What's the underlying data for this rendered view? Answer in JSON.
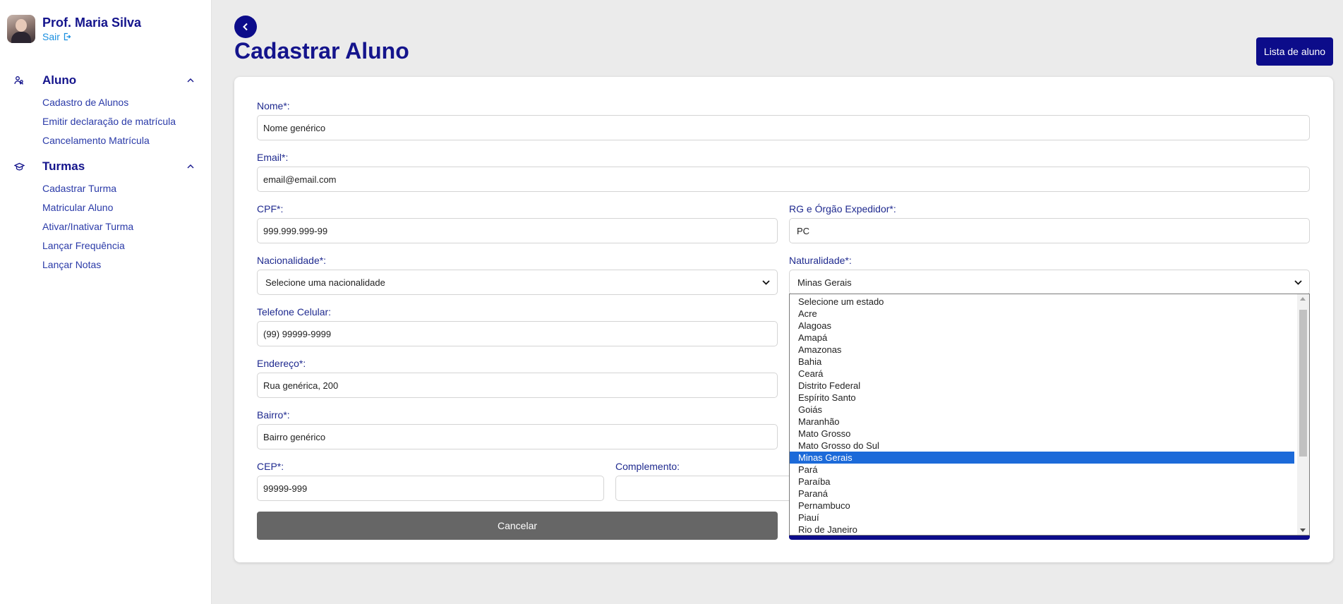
{
  "colors": {
    "primary": "#0c0c8a",
    "title": "#14148c",
    "link": "#1a8fe0",
    "cancel": "#666666",
    "selected_option": "#1c6ad9"
  },
  "sidebar": {
    "profile": {
      "name": "Prof. Maria Silva",
      "logout": "Sair"
    },
    "sections": [
      {
        "label": "Aluno",
        "icon": "users-icon",
        "items": [
          "Cadastro de Alunos",
          "Emitir declaração de matrícula",
          "Cancelamento Matrícula"
        ]
      },
      {
        "label": "Turmas",
        "icon": "graduation-cap-icon",
        "items": [
          "Cadastrar Turma",
          "Matricular Aluno",
          "Ativar/Inativar Turma",
          "Lançar Frequência",
          "Lançar Notas"
        ]
      }
    ]
  },
  "header": {
    "title": "Cadastrar Aluno",
    "list_button": "Lista de aluno"
  },
  "form": {
    "nome": {
      "label": "Nome*:",
      "value": "Nome genérico"
    },
    "email": {
      "label": "Email*:",
      "value": "email@email.com"
    },
    "cpf": {
      "label": "CPF*:",
      "value": "999.999.999-99"
    },
    "rg": {
      "label": "RG e Órgão Expedidor*:",
      "value": "PC"
    },
    "nacionalidade": {
      "label": "Nacionalidade*:",
      "value": "Selecione uma nacionalidade"
    },
    "naturalidade": {
      "label": "Naturalidade*:",
      "value": "Minas Gerais"
    },
    "telefone": {
      "label": "Telefone Celular:",
      "value": "(99) 99999-9999"
    },
    "endereco": {
      "label": "Endereço*:",
      "value": "Rua genérica, 200"
    },
    "bairro": {
      "label": "Bairro*:",
      "value": "Bairro genérico"
    },
    "cep": {
      "label": "CEP*:",
      "value": "99999-999"
    },
    "complemento": {
      "label": "Complemento:",
      "value": ""
    },
    "cancel_button": "Cancelar"
  },
  "dropdown": {
    "selected": "Minas Gerais",
    "options": [
      "Selecione um estado",
      "Acre",
      "Alagoas",
      "Amapá",
      "Amazonas",
      "Bahia",
      "Ceará",
      "Distrito Federal",
      "Espírito Santo",
      "Goiás",
      "Maranhão",
      "Mato Grosso",
      "Mato Grosso do Sul",
      "Minas Gerais",
      "Pará",
      "Paraíba",
      "Paraná",
      "Pernambuco",
      "Piauí",
      "Rio de Janeiro"
    ]
  }
}
